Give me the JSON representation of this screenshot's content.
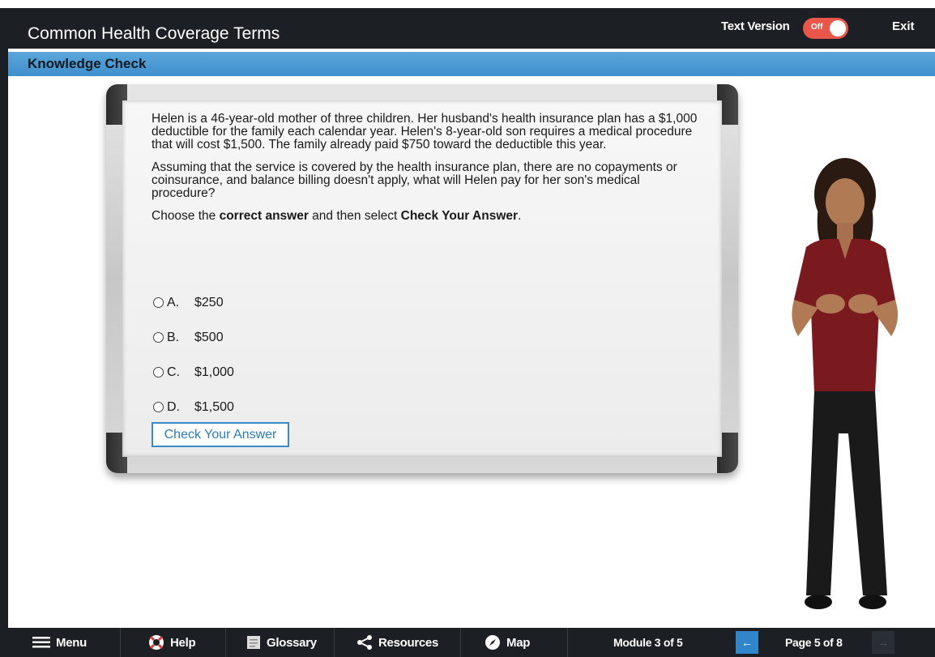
{
  "header": {
    "title": "Common Health Coverage Terms",
    "text_version_label": "Text Version",
    "toggle_state": "Off",
    "exit_label": "Exit"
  },
  "section": {
    "title": "Knowledge Check"
  },
  "question": {
    "paragraph1": "Helen is a 46-year-old mother of three children. Her husband's health insurance plan has a $1,000 deductible for the family each calendar year. Helen's 8-year-old son requires a medical procedure that will cost $1,500. The family already paid $750 toward the deductible this year.",
    "paragraph2": "Assuming that the service is covered by the health insurance plan, there are no copayments or coinsurance, and balance billing doesn't apply, what will Helen pay for her son's medical procedure?",
    "instruction_prefix": "Choose the ",
    "instruction_bold1": "correct answer",
    "instruction_middle": " and then select ",
    "instruction_bold2": "Check Your Answer",
    "instruction_suffix": "."
  },
  "options": [
    {
      "letter": "A.",
      "value": "$250"
    },
    {
      "letter": "B.",
      "value": "$500"
    },
    {
      "letter": "C.",
      "value": "$1,000"
    },
    {
      "letter": "D.",
      "value": "$1,500"
    }
  ],
  "check_button_label": "Check Your Answer",
  "footer": {
    "menu_label": "Menu",
    "help_label": "Help",
    "glossary_label": "Glossary",
    "resources_label": "Resources",
    "map_label": "Map",
    "module_text": "Module 3 of 5",
    "page_text": "Page 5 of 8",
    "prev_icon": "arrow-left-icon",
    "next_icon": "arrow-right-icon"
  },
  "colors": {
    "topbar": "#1c1f24",
    "subbar": "#4a98d1",
    "toggle": "#e8574a",
    "accent": "#2f86c9"
  }
}
